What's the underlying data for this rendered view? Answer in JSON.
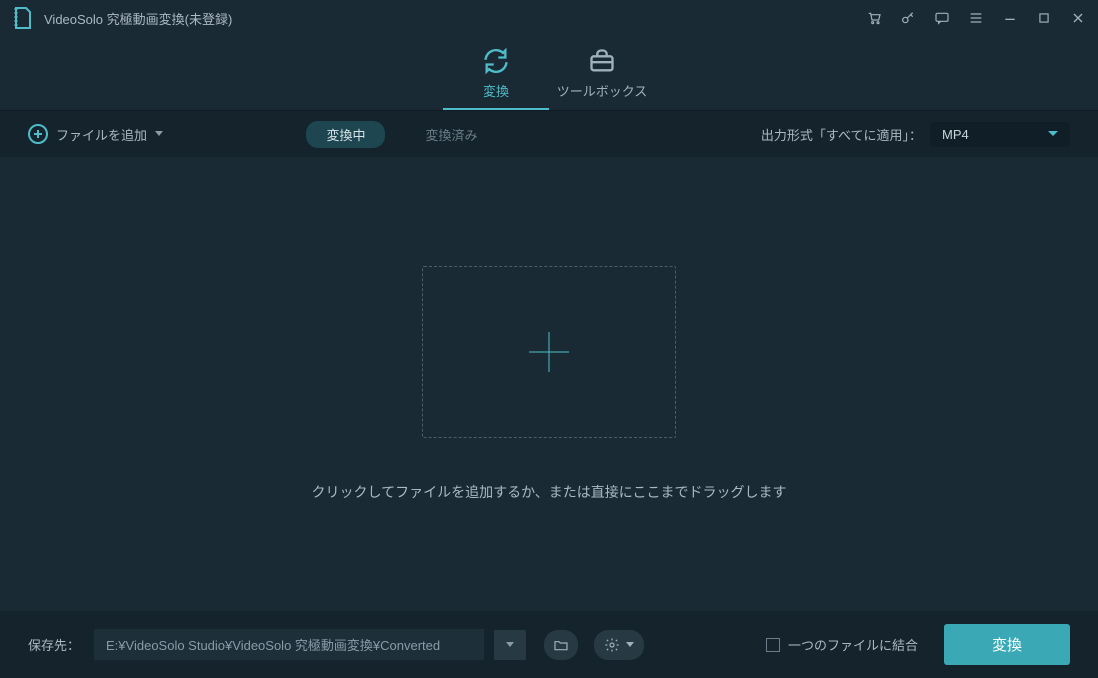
{
  "title": "VideoSolo 究極動画変換(未登録)",
  "nav": {
    "convert": "変換",
    "toolbox": "ツールボックス"
  },
  "toolbar": {
    "add_file": "ファイルを追加",
    "converting": "変換中",
    "converted": "変換済み",
    "output_label": "出力形式「すべてに適用」：",
    "format": "MP4"
  },
  "main": {
    "drop_hint": "クリックしてファイルを追加するか、または直接にここまでドラッグします"
  },
  "bottom": {
    "save_label": "保存先：",
    "path": "E:¥VideoSolo Studio¥VideoSolo 究極動画変換¥Converted",
    "merge_label": "一つのファイルに結合",
    "convert": "変換"
  }
}
